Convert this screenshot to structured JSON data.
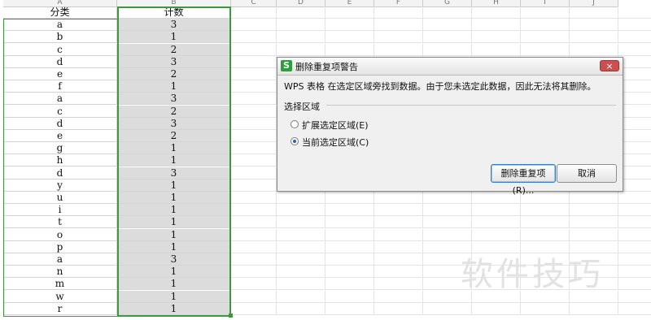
{
  "spreadsheet": {
    "columns": [
      "A",
      "B",
      "C",
      "D",
      "E",
      "F",
      "G",
      "H",
      "I",
      "J"
    ],
    "header": {
      "category": "分类",
      "count": "计数"
    },
    "rows": [
      {
        "category": "a",
        "count": "3"
      },
      {
        "category": "b",
        "count": "1"
      },
      {
        "category": "c",
        "count": "2"
      },
      {
        "category": "d",
        "count": "3"
      },
      {
        "category": "e",
        "count": "2"
      },
      {
        "category": "f",
        "count": "1"
      },
      {
        "category": "a",
        "count": "3"
      },
      {
        "category": "c",
        "count": "2"
      },
      {
        "category": "d",
        "count": "3"
      },
      {
        "category": "e",
        "count": "2"
      },
      {
        "category": "g",
        "count": "1"
      },
      {
        "category": "h",
        "count": "1"
      },
      {
        "category": "d",
        "count": "3"
      },
      {
        "category": "y",
        "count": "1"
      },
      {
        "category": "u",
        "count": "1"
      },
      {
        "category": "i",
        "count": "1"
      },
      {
        "category": "t",
        "count": "1"
      },
      {
        "category": "o",
        "count": "1"
      },
      {
        "category": "p",
        "count": "1"
      },
      {
        "category": "a",
        "count": "3"
      },
      {
        "category": "n",
        "count": "1"
      },
      {
        "category": "m",
        "count": "1"
      },
      {
        "category": "w",
        "count": "1"
      },
      {
        "category": "r",
        "count": "1"
      }
    ]
  },
  "dialog": {
    "app_icon": "S",
    "title": "删除重复项警告",
    "close": "×",
    "message": "WPS 表格 在选定区域旁找到数据。由于您未选定此数据，因此无法将其删除。",
    "group_label": "选择区域",
    "option_expand": "扩展选定区域(E)",
    "option_current": "当前选定区域(C)",
    "selected_option": "current",
    "remove_button": "删除重复项(R)...",
    "cancel_button": "取消"
  },
  "watermark": "软件技巧",
  "colors": {
    "selection": "#3c9a3c",
    "selected_fill": "#dcdcdc",
    "close": "#c75050"
  }
}
